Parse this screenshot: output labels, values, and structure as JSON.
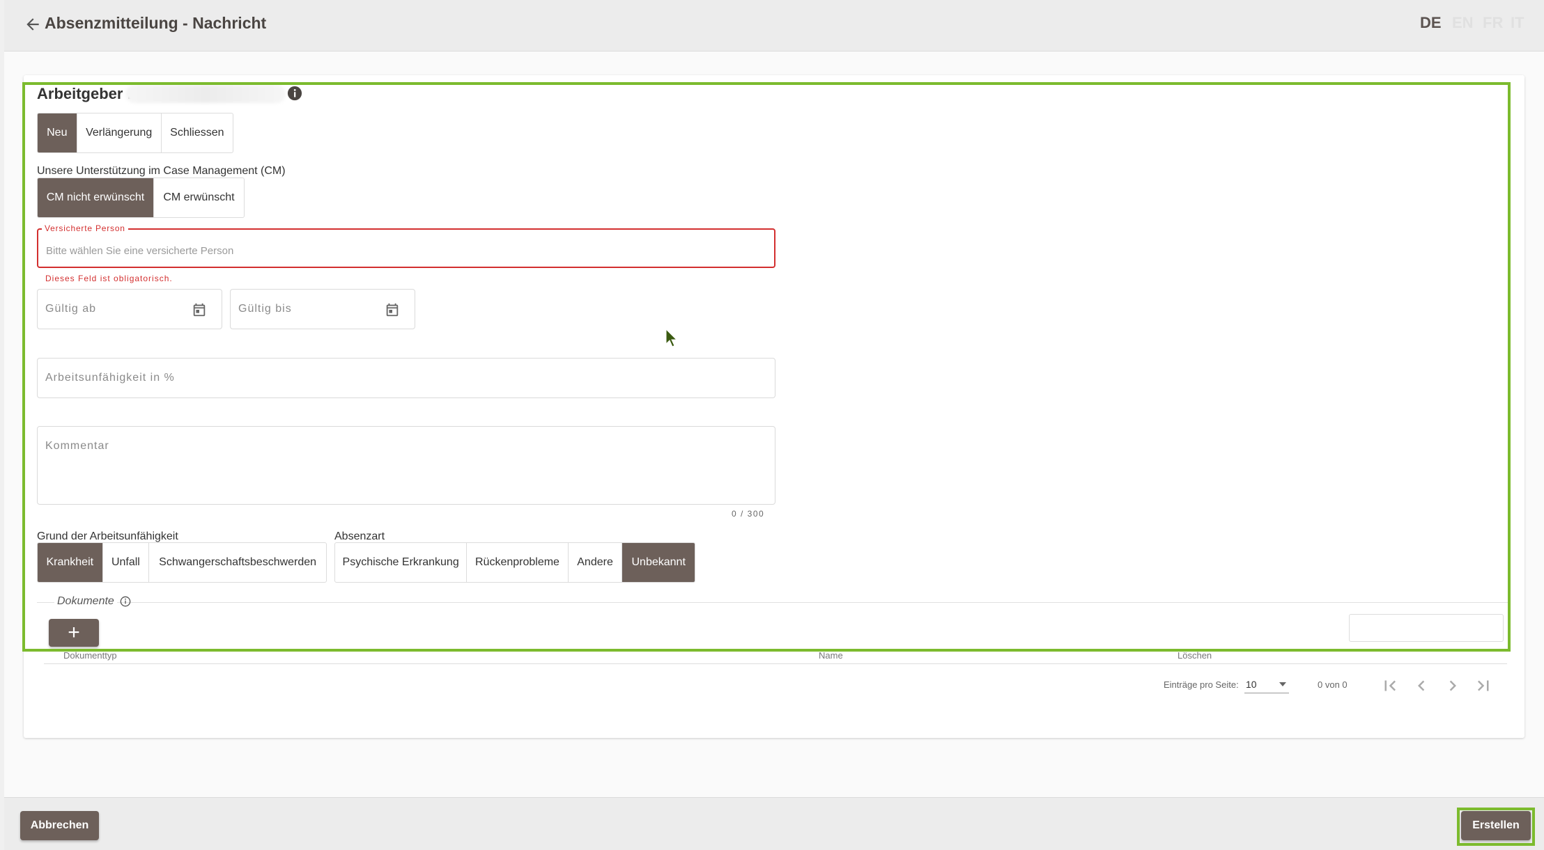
{
  "header": {
    "title": "Absenzmitteilung - Nachricht",
    "languages": [
      "DE",
      "EN",
      "FR",
      "IT"
    ],
    "active_language": "DE"
  },
  "employer": {
    "title": "Arbeitgeber ."
  },
  "message_type": {
    "options": [
      "Neu",
      "Verlängerung",
      "Schliessen"
    ],
    "selected": "Neu"
  },
  "case_management": {
    "label": "Unsere Unterstützung im Case Management (CM)",
    "options": [
      "CM nicht erwünscht",
      "CM erwünscht"
    ],
    "selected": "CM nicht erwünscht"
  },
  "insured_person": {
    "label": "Versicherte Person",
    "placeholder": "Bitte wählen Sie eine versicherte Person",
    "error": "Dieses Feld ist obligatorisch."
  },
  "valid_from": {
    "placeholder": "Gültig ab"
  },
  "valid_to": {
    "placeholder": "Gültig bis"
  },
  "incapacity_percent": {
    "placeholder": "Arbeitsunfähigkeit in %"
  },
  "comment": {
    "placeholder": "Kommentar",
    "counter": "0 / 300"
  },
  "incapacity_reason": {
    "label": "Grund der Arbeitsunfähigkeit",
    "options": [
      "Krankheit",
      "Unfall",
      "Schwangerschaftsbeschwerden"
    ],
    "selected": "Krankheit"
  },
  "absence_type": {
    "label": "Absenzart",
    "options": [
      "Psychische Erkrankung",
      "Rückenprobleme",
      "Andere",
      "Unbekannt"
    ],
    "selected": "Unbekannt"
  },
  "documents": {
    "label": "Dokumente",
    "add_label": "+",
    "columns": [
      "Dokumenttyp",
      "Name",
      "Löschen"
    ],
    "rows": []
  },
  "pagination": {
    "per_page_label": "Einträge pro Seite:",
    "per_page": "10",
    "range": "0 von 0"
  },
  "footer": {
    "cancel_label": "Abbrechen",
    "create_label": "Erstellen"
  },
  "colors": {
    "accent": "#6d605a",
    "highlight": "#7cbb2e",
    "error": "#d32f2f"
  }
}
